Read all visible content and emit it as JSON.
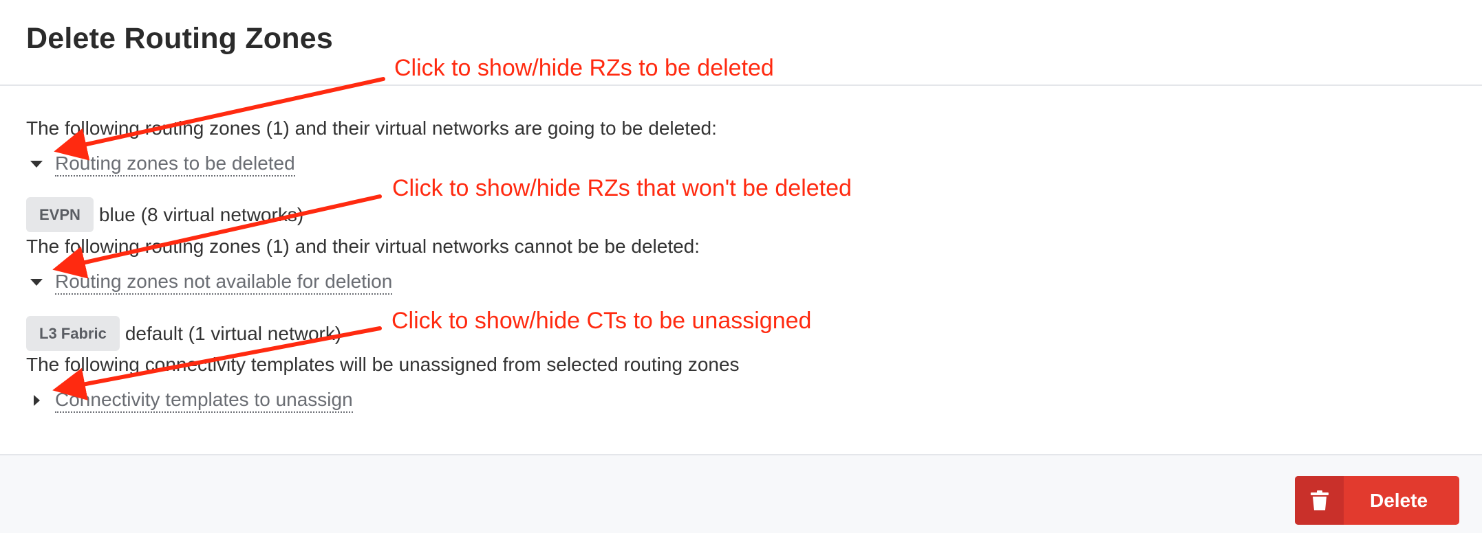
{
  "modal": {
    "title": "Delete Routing Zones"
  },
  "sections": {
    "to_delete": {
      "description": "The following routing zones (1) and their virtual networks are going to be deleted:",
      "toggle_label": "Routing zones to be deleted",
      "expanded": true,
      "zones": [
        {
          "badge": "EVPN",
          "text": "blue (8 virtual networks)"
        }
      ]
    },
    "not_deletable": {
      "description": "The following routing zones (1) and their virtual networks cannot be be deleted:",
      "toggle_label": "Routing zones not available for deletion",
      "expanded": true,
      "zones": [
        {
          "badge": "L3 Fabric",
          "text": "default (1 virtual network)"
        }
      ]
    },
    "unassign": {
      "description": "The following connectivity templates will be unassigned from selected routing zones",
      "toggle_label": "Connectivity templates to unassign",
      "expanded": false
    }
  },
  "footer": {
    "delete_label": "Delete",
    "delete_icon": "trash-icon"
  },
  "annotations": {
    "items": [
      "Click to show/hide RZs to be deleted",
      "Click to show/hide RZs that won't be deleted",
      "Click to show/hide CTs to be unassigned"
    ],
    "color": "#ff2a10"
  },
  "colors": {
    "danger": "#e23a2e",
    "danger_dark": "#c9302a",
    "badge_bg": "#e6e7e9",
    "footer_bg": "#f7f8fa"
  }
}
